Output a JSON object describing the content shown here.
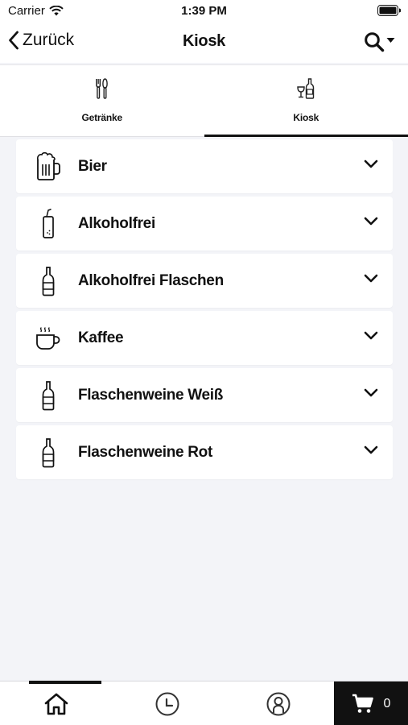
{
  "status_bar": {
    "carrier": "Carrier",
    "time": "1:39 PM"
  },
  "nav": {
    "back_label": "Zurück",
    "title": "Kiosk"
  },
  "tabs": [
    {
      "label": "Getränke",
      "icon": "cutlery-icon",
      "active": false
    },
    {
      "label": "Kiosk",
      "icon": "wine-bottle-glass-icon",
      "active": true
    }
  ],
  "categories": [
    {
      "label": "Bier",
      "icon": "beer-mug-icon"
    },
    {
      "label": "Alkoholfrei",
      "icon": "soda-can-straw-icon"
    },
    {
      "label": "Alkoholfrei Flaschen",
      "icon": "bottle-icon"
    },
    {
      "label": "Kaffee",
      "icon": "coffee-cup-icon"
    },
    {
      "label": "Flaschenweine Weiß",
      "icon": "bottle-icon"
    },
    {
      "label": "Flaschenweine Rot",
      "icon": "bottle-icon"
    }
  ],
  "tab_bar": {
    "items": [
      {
        "icon": "home-icon",
        "active": true
      },
      {
        "icon": "clock-icon",
        "active": false
      },
      {
        "icon": "account-icon",
        "active": false
      }
    ],
    "cart_count": "0"
  }
}
